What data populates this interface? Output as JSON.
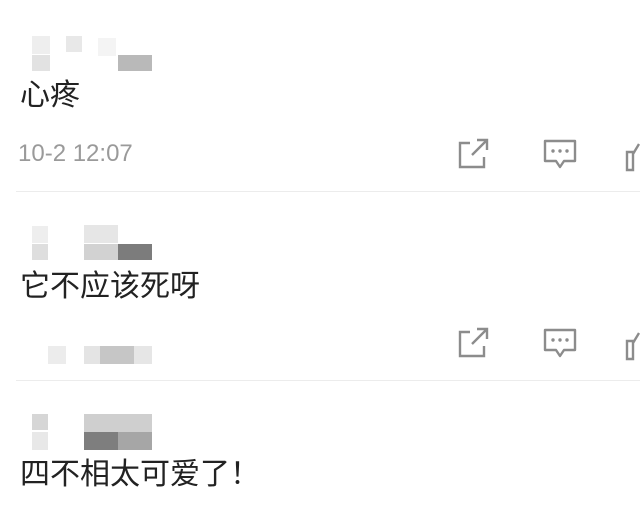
{
  "comments": [
    {
      "text": "心疼",
      "time": "10-2 12:07",
      "icons": [
        "share-icon",
        "reply-icon",
        "like-icon"
      ]
    },
    {
      "text": "它不应该死呀",
      "time": "",
      "icons": [
        "share-icon",
        "reply-icon",
        "like-icon"
      ]
    },
    {
      "text": "四不相太可爱了！",
      "time": "",
      "icons": [
        "share-icon",
        "reply-icon",
        "like-icon"
      ]
    }
  ],
  "colors": {
    "text": "#222222",
    "meta": "#9a9a9a",
    "icon": "#8c8c8c",
    "divider": "#ececec"
  }
}
